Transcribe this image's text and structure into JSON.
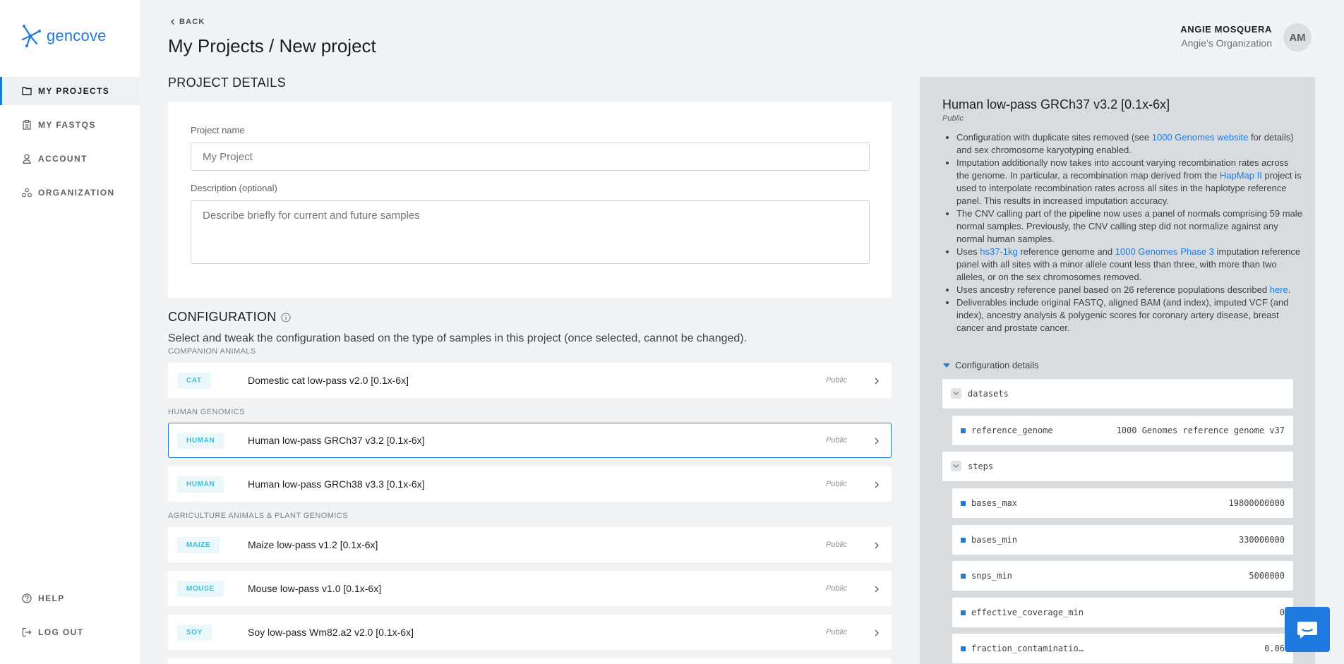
{
  "brand": {
    "name": "gencove",
    "accent": "#1f7ae0"
  },
  "sidebar": {
    "items": [
      {
        "label": "MY PROJECTS",
        "icon": "folder-icon",
        "active": true
      },
      {
        "label": "MY FASTQS",
        "icon": "clipboard-icon"
      },
      {
        "label": "ACCOUNT",
        "icon": "user-icon"
      },
      {
        "label": "ORGANIZATION",
        "icon": "organization-icon"
      }
    ],
    "bottom": [
      {
        "label": "HELP",
        "icon": "help-icon"
      },
      {
        "label": "LOG OUT",
        "icon": "logout-icon"
      }
    ]
  },
  "header": {
    "back_label": "BACK",
    "title": "My Projects / New project",
    "user_name": "ANGIE MOSQUERA",
    "user_org": "Angie's Organization",
    "avatar_initials": "AM"
  },
  "details": {
    "section_title": "PROJECT DETAILS",
    "name_label": "Project name",
    "name_placeholder": "My Project",
    "desc_label": "Description (optional)",
    "desc_placeholder": "Describe briefly for current and future samples"
  },
  "configuration": {
    "section_title": "CONFIGURATION",
    "description": "Select and tweak the configuration based on the type of samples in this project (once selected, cannot be changed).",
    "groups": [
      {
        "label": "COMPANION ANIMALS"
      },
      {
        "label": "HUMAN GENOMICS"
      },
      {
        "label": "AGRICULTURE ANIMALS & PLANT GENOMICS"
      }
    ],
    "rows": [
      {
        "tag": "CAT",
        "name": "Domestic cat low-pass v2.0 [0.1x-6x]",
        "visibility": "Public"
      },
      {
        "tag": "HUMAN",
        "name": "Human low-pass GRCh37 v3.2 [0.1x-6x]",
        "visibility": "Public",
        "selected": true
      },
      {
        "tag": "HUMAN",
        "name": "Human low-pass GRCh38 v3.3 [0.1x-6x]",
        "visibility": "Public"
      },
      {
        "tag": "MAIZE",
        "name": "Maize low-pass v1.2 [0.1x-6x]",
        "visibility": "Public"
      },
      {
        "tag": "MOUSE",
        "name": "Mouse low-pass v1.0 [0.1x-6x]",
        "visibility": "Public"
      },
      {
        "tag": "SOY",
        "name": "Soy low-pass Wm82.a2 v2.0 [0.1x-6x]",
        "visibility": "Public"
      }
    ]
  },
  "panel": {
    "title": "Human low-pass GRCh37 v3.2 [0.1x-6x]",
    "visibility": "Public",
    "bullets": {
      "b1_pre": "Configuration with duplicate sites removed (see ",
      "b1_link": "1000 Genomes website",
      "b1_post": " for details) and sex chromosome karyotyping enabled.",
      "b2_pre": "Imputation additionally now takes into account varying recombination rates across the genome. In particular, a recombination map derived from the ",
      "b2_link": "HapMap II",
      "b2_post": " project is used to interpolate recombination rates across all sites in the haplotype reference panel. This results in increased imputation accuracy.",
      "b3": "The CNV calling part of the pipeline now uses a panel of normals comprising 59 male normal samples. Previously, the CNV calling step did not normalize against any normal human samples.",
      "b4_pre": "Uses ",
      "b4_link1": "hs37-1kg",
      "b4_mid": " reference genome and ",
      "b4_link2": "1000 Genomes Phase 3",
      "b4_post": " imputation reference panel with all sites with a minor allele count less than three, with more than two alleles, or on the sex chromosomes removed.",
      "b5_pre": "Uses ancestry reference panel based on 26 reference populations described ",
      "b5_link": "here",
      "b5_post": ".",
      "b6": "Deliverables include original FASTQ, aligned BAM (and index), imputed VCF (and index), ancestry analysis & polygenic scores for coronary artery disease, breast cancer and prostate cancer."
    },
    "details_toggle": "Configuration details",
    "tree": {
      "datasets_key": "datasets",
      "datasets_items": [
        {
          "key": "reference_genome",
          "value": "1000 Genomes reference genome v37"
        }
      ],
      "steps_key": "steps",
      "steps_items": [
        {
          "key": "bases_max",
          "value": "19800000000"
        },
        {
          "key": "bases_min",
          "value": "330000000"
        },
        {
          "key": "snps_min",
          "value": "5000000"
        },
        {
          "key": "effective_coverage_min",
          "value": "0"
        },
        {
          "key": "fraction_contaminatio…",
          "value": "0.06"
        }
      ]
    }
  }
}
